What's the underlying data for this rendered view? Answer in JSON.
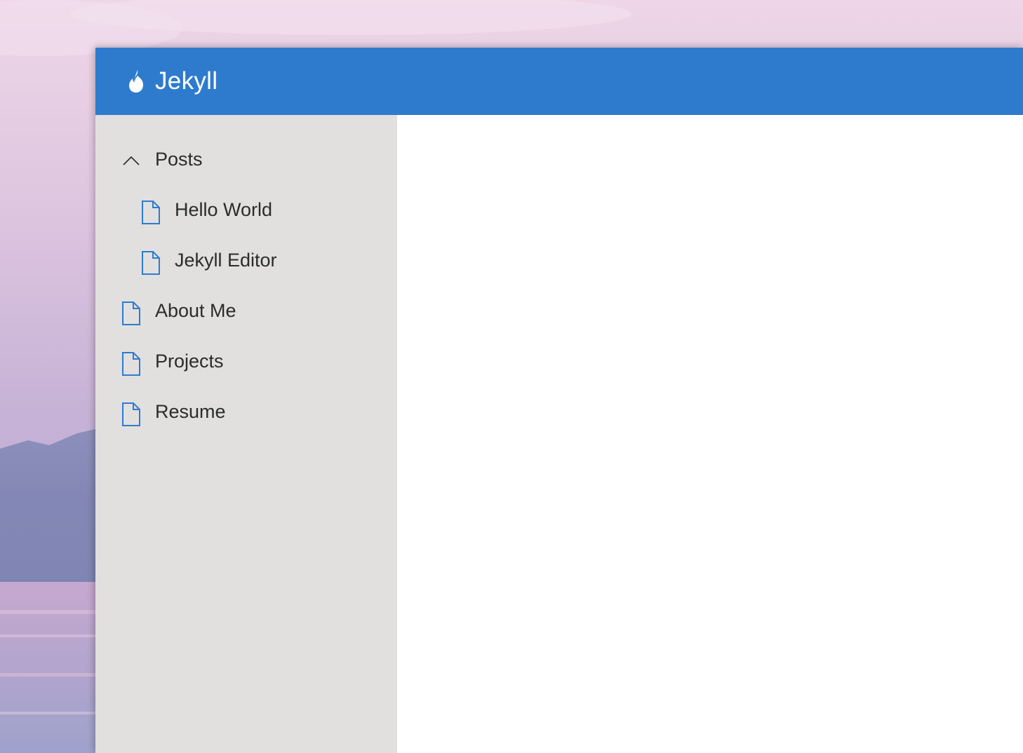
{
  "window": {
    "app_title": "Jekyll",
    "app_icon": "flame-icon",
    "titlebar_color": "#2e7bce",
    "sidebar_color": "#e1e0df",
    "icon_color": "#2e7bce"
  },
  "sidebar": {
    "items": [
      {
        "label": "Posts",
        "icon": "chevron-up-icon",
        "type": "folder",
        "expanded": true,
        "depth": 0
      },
      {
        "label": "Hello World",
        "icon": "document-icon",
        "type": "file",
        "depth": 1
      },
      {
        "label": "Jekyll Editor",
        "icon": "document-icon",
        "type": "file",
        "depth": 1
      },
      {
        "label": "About Me",
        "icon": "document-icon",
        "type": "file",
        "depth": 0
      },
      {
        "label": "Projects",
        "icon": "document-icon",
        "type": "file",
        "depth": 0
      },
      {
        "label": "Resume",
        "icon": "document-icon",
        "type": "file",
        "depth": 0
      }
    ]
  }
}
